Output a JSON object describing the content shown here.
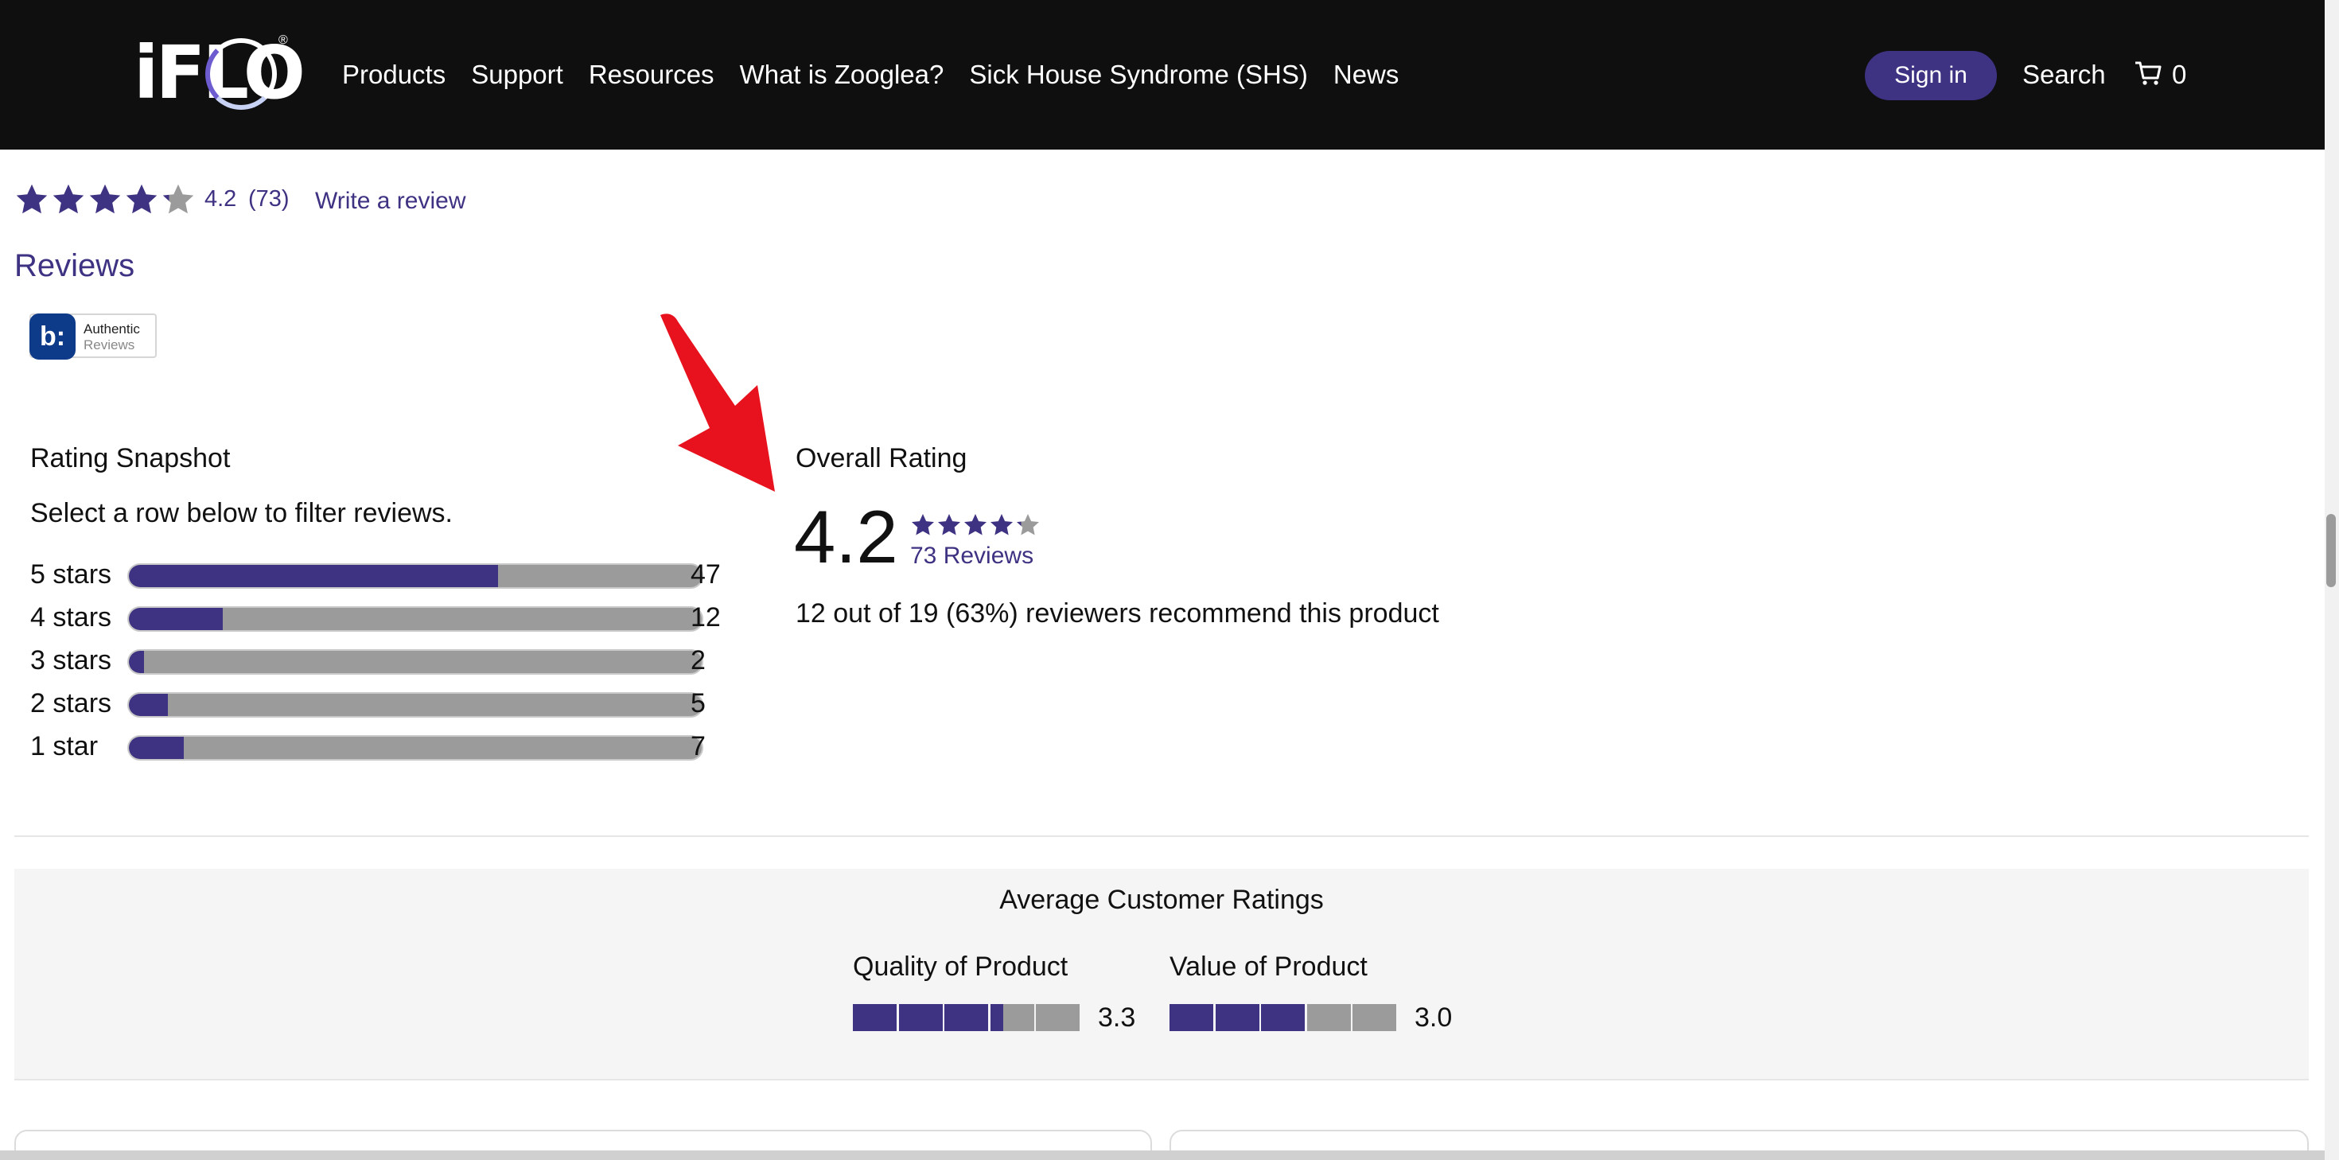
{
  "header": {
    "logo_text": "iFLO",
    "nav": [
      "Products",
      "Support",
      "Resources",
      "What is Zooglea?",
      "Sick House Syndrome (SHS)",
      "News"
    ],
    "signin_label": "Sign in",
    "search_label": "Search",
    "cart_count": "0"
  },
  "summary": {
    "rating": "4.2",
    "count": "(73)",
    "write_review": "Write a review",
    "stars": 4.2
  },
  "reviews_title": "Reviews",
  "badge": {
    "mark": "b:",
    "line1": "Authentic",
    "line2": "Reviews"
  },
  "snapshot": {
    "title": "Rating Snapshot",
    "hint": "Select a row below to filter reviews.",
    "rows": [
      {
        "label": "5 stars",
        "count": "47",
        "fraction": 0.644
      },
      {
        "label": "4 stars",
        "count": "12",
        "fraction": 0.164
      },
      {
        "label": "3 stars",
        "count": "2",
        "fraction": 0.027
      },
      {
        "label": "2 stars",
        "count": "5",
        "fraction": 0.068
      },
      {
        "label": "1 star",
        "count": "7",
        "fraction": 0.096
      }
    ]
  },
  "overall": {
    "title": "Overall Rating",
    "score": "4.2",
    "stars": 4.2,
    "count_label": "73 Reviews",
    "recommend": "12 out of 19 (63%) reviewers recommend this product"
  },
  "average": {
    "title": "Average Customer Ratings",
    "items": [
      {
        "label": "Quality of Product",
        "value": "3.3",
        "score": 3.3
      },
      {
        "label": "Value of Product",
        "value": "3.0",
        "score": 3.0
      }
    ]
  },
  "colors": {
    "brand": "#3e3282",
    "bar_empty": "#9b9b9b",
    "header_bg": "#0f0f0f",
    "annotation": "#e8121e"
  }
}
